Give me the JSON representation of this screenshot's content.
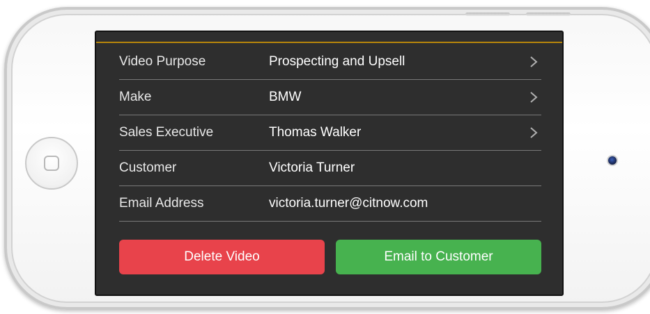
{
  "details": [
    {
      "label": "Video Purpose",
      "value": "Prospecting and Upsell",
      "has_chevron": true
    },
    {
      "label": "Make",
      "value": "BMW",
      "has_chevron": true
    },
    {
      "label": "Sales Executive",
      "value": "Thomas Walker",
      "has_chevron": true
    },
    {
      "label": "Customer",
      "value": "Victoria Turner",
      "has_chevron": false
    },
    {
      "label": "Email Address",
      "value": "victoria.turner@citnow.com",
      "has_chevron": false
    }
  ],
  "actions": {
    "delete_label": "Delete Video",
    "email_label": "Email to Customer"
  },
  "colors": {
    "delete": "#e8434b",
    "email": "#47b24f",
    "accent_line": "#b8860b",
    "screen_bg": "#2e2e2e"
  },
  "icons": {
    "chevron": "chevron-right-icon",
    "home": "home-button-icon",
    "camera": "camera-icon"
  }
}
